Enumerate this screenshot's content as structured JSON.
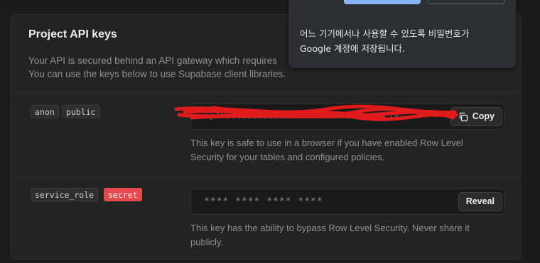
{
  "card": {
    "title": "Project API keys",
    "description_line1": "Your API is secured behind an API gateway which requires",
    "description_line2": "You can use the keys below to use Supabase client libraries."
  },
  "keys": [
    {
      "tags": [
        "anon",
        "public"
      ],
      "value": "eyJhbGciOiJIUzI1NiIsInR5cCI6IkpXVCJ9",
      "action_label": "Copy",
      "action_icon": "copy-icon",
      "hint_line1": "This key is safe to use in a browser if you have enabled Row Level",
      "hint_line2": "Security for your tables and configured policies."
    },
    {
      "tags": [
        "service_role",
        "secret"
      ],
      "value": "**** **** **** ****",
      "action_label": "Reveal",
      "hint_line1": "This key has the ability to bypass Row Level Security. Never share it",
      "hint_line2": "publicly."
    }
  ],
  "popup": {
    "line1": "어느 기기에서나 사용할 수 있도록 비밀번호가",
    "line2": "Google 계정에 저장됩니다."
  },
  "colors": {
    "background": "#1c1c1c",
    "card": "#232323",
    "secret_badge": "#e5484d",
    "redaction": "#e01b1b",
    "popup_primary": "#8ab4f8"
  }
}
